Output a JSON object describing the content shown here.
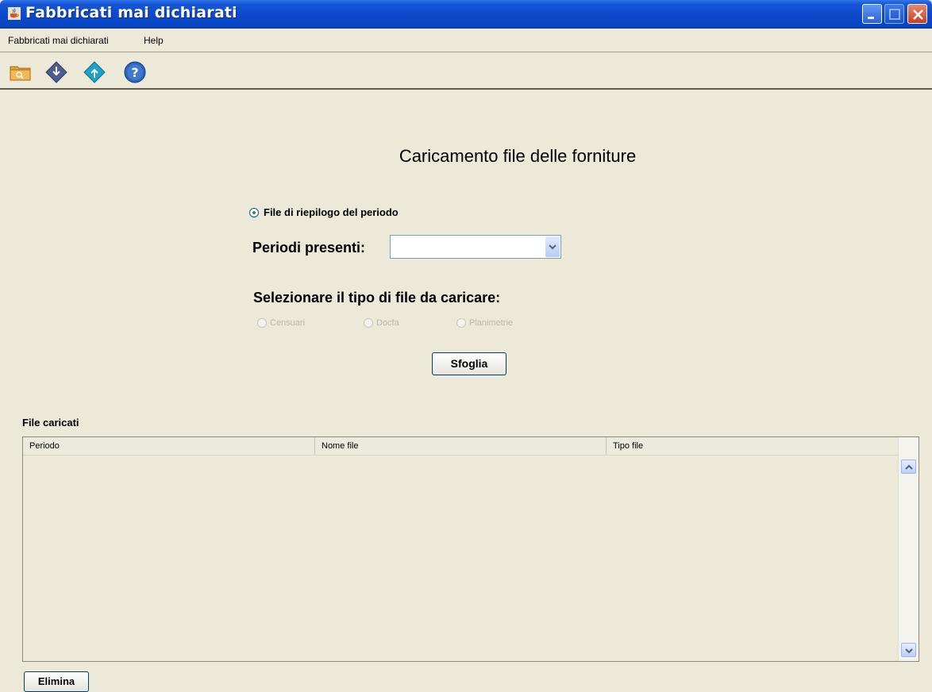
{
  "window": {
    "title": "Fabbricati mai dichiarati",
    "icon": "java-cup-icon"
  },
  "menu": [
    "Fabbricati mai dichiarati",
    "Help"
  ],
  "toolbar": {
    "buttons": [
      "open-folder-icon",
      "download-icon",
      "upload-icon",
      "help-icon"
    ]
  },
  "main": {
    "title": "Caricamento file delle forniture",
    "radio_riepilogo": "File di riepilogo del periodo",
    "periodi_label": "Periodi presenti:",
    "periodi_value": "",
    "tipo_label": "Selezionare il tipo di file da caricare:",
    "tipo_options": [
      "Censuari",
      "Docfa",
      "Planimetrie"
    ],
    "sfoglia": "Sfoglia"
  },
  "files": {
    "section_label": "File caricati",
    "columns": [
      "Periodo",
      "Nome file",
      "Tipo file"
    ],
    "rows": [],
    "elimina": "Elimina"
  },
  "colors": {
    "titlebar": "#0a47c9",
    "background": "#ece9d8",
    "selected_radio": "#21a121"
  }
}
